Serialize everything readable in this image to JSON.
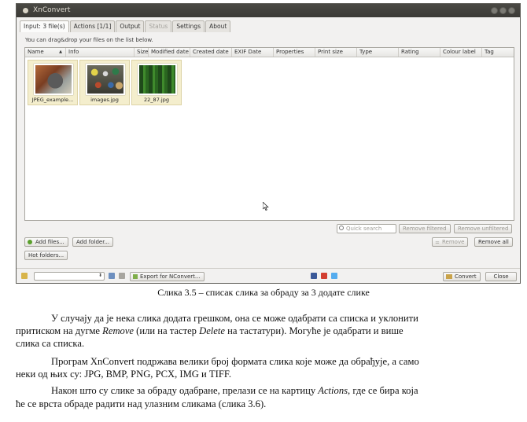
{
  "window": {
    "title": "XnConvert",
    "tabs": [
      {
        "label": "Input: 3 file(s)",
        "state": "active"
      },
      {
        "label": "Actions [1/1]",
        "state": "normal"
      },
      {
        "label": "Output",
        "state": "normal"
      },
      {
        "label": "Status",
        "state": "disabled"
      },
      {
        "label": "Settings",
        "state": "normal"
      },
      {
        "label": "About",
        "state": "normal"
      }
    ],
    "hint": "You can drag&drop your files on the list below.",
    "columns": [
      "Name",
      "Info",
      "Size",
      "Modified date",
      "Created date",
      "EXIF Date",
      "Properties",
      "Print size",
      "Type",
      "Rating",
      "Colour label",
      "Tag"
    ],
    "sort_indicator": "▲",
    "files": [
      {
        "name": "JPEG_example...",
        "thumb": "grey-textured-object"
      },
      {
        "name": "images.jpg",
        "thumb": "colored-balls"
      },
      {
        "name": "22_87.jpg",
        "thumb": "green-forest"
      }
    ],
    "search_placeholder": "Quick search",
    "buttons": {
      "remove_filtered": "Remove filtered",
      "remove_unfiltered": "Remove unfiltered",
      "add_files": "Add files...",
      "add_folder": "Add folder...",
      "remove": "Remove",
      "remove_all": "Remove all",
      "hot_folders": "Hot folders...",
      "export": "Export for NConvert...",
      "convert": "Convert",
      "close": "Close"
    },
    "accent_color": "#f4eecd"
  },
  "document": {
    "caption": "Слика 3.5 – списак слика за обраду за 3 додате слике",
    "p1_a": "У случају да је нека слика додата грешком, она се може одабрати са списка и уклонити",
    "p1_b_pre": "притиском на дугме ",
    "p1_b_em1": "Remove",
    "p1_b_mid": " (или на тастер ",
    "p1_b_em2": "Delete",
    "p1_b_post": " на тастатури). Могуће је одабрати и више",
    "p1_c": "слика са списка.",
    "p2_a": "Програм XnConvert подржава велики број формата слика које може да обрађује, а само",
    "p2_b": "неки од њих су: JPG, BMP, PNG, PCX, IMG и TIFF.",
    "p3_a_pre": "Након што су слике за обраду одабране, прелази се на картицу ",
    "p3_a_em": "Actions",
    "p3_a_post": ", где се бира која",
    "p3_b": "ће се врста обраде радити над улазним сликама (слика 3.6)."
  }
}
